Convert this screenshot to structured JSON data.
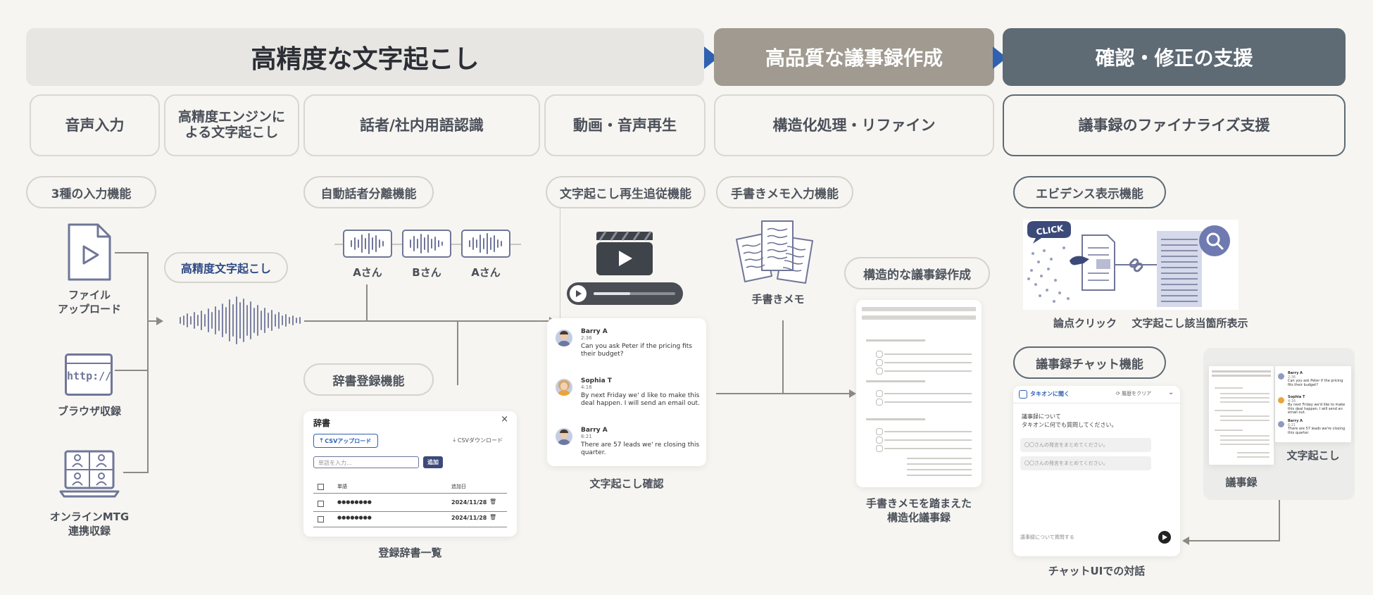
{
  "phases": [
    {
      "label": "高精度な文字起こし",
      "color": "#e7e6e3",
      "text_color": "#2b2e34"
    },
    {
      "label": "高品質な議事録作成",
      "color": "#a09a90",
      "text_color": "#ffffff"
    },
    {
      "label": "確認・修正の支援",
      "color": "#5e6a74",
      "text_color": "#ffffff"
    }
  ],
  "features": [
    "音声入力",
    "高精度エンジンによる文字起こし",
    "話者/社内用語認識",
    "動画・音声再生",
    "構造化処理・リファイン",
    "議事録のファイナライズ支援"
  ],
  "functions": {
    "input": "3種の入力機能",
    "diarization": "自動話者分離機能",
    "playback_follow": "文字起こし再生追従機能",
    "handwritten_input": "手書きメモ入力機能",
    "structured_minutes": "構造的な議事録作成",
    "evidence": "エビデンス表示機能",
    "dictionary": "辞書登録機能",
    "minutes_chat": "議事録チャット機能",
    "high_precision": "高精度文字起こし"
  },
  "inputs": {
    "file_upload": [
      "ファイル",
      "アップロード"
    ],
    "browser": "ブラウザ収録",
    "browser_url": "http://",
    "online": [
      "オンラインMTG",
      "連携収録"
    ]
  },
  "speakers": [
    "Aさん",
    "Bさん",
    "Aさん"
  ],
  "captions": {
    "dictionary_list": "登録辞書一覧",
    "transcript_check": "文字起こし確認",
    "handwritten_memo": "手書きメモ",
    "structured_result": [
      "手書きメモを踏まえた",
      "構造化議事録"
    ],
    "point_click": "論点クリック",
    "show_location": "文字起こし該当箇所表示",
    "chat_dialogue": "チャットUIでの対話",
    "minutes": "議事録",
    "transcript": "文字起こし"
  },
  "evidence": {
    "click_badge": "CLICK"
  },
  "dictionary_ui": {
    "title": "辞書",
    "close": "×",
    "upload_btn": "CSVアップロード",
    "download_btn": "CSVダウンロード",
    "input_placeholder": "単語を入力...",
    "add_btn": "追加",
    "col_word": "単語",
    "col_date": "追加日",
    "rows": [
      {
        "word": "●●●●●●●●",
        "date": "2024/11/28"
      },
      {
        "word": "●●●●●●●●",
        "date": "2024/11/28"
      }
    ]
  },
  "transcript_messages": [
    {
      "name": "Barry A",
      "time": "2:36",
      "text": "Can you ask Peter if the pricing fits their budget?"
    },
    {
      "name": "Sophia T",
      "time": "4:16",
      "text": "By next Friday we' d like to make this deal happen. I will send an email out."
    },
    {
      "name": "Barry A",
      "time": "6:21",
      "text": "There are 57 leads we' re closing this quarter."
    }
  ],
  "chat_ui": {
    "header_title": "タキオンに聞く",
    "clear_history": "履歴をクリア",
    "intro_line1": "議事録について",
    "intro_line2": "タキオンに何でも質問してください。",
    "suggestion1": "〇〇さんの発言をまとめてください。",
    "suggestion2": "〇〇さんの発言をまとめてください。",
    "input_placeholder": "議事録について質問する"
  },
  "mini_transcript": [
    {
      "name": "Barry A",
      "time": "2:36",
      "text": "Can you ask Peter if the pricing fits their budget?"
    },
    {
      "name": "Sophia T",
      "time": "4:16",
      "text": "By next Friday we'd like to make this deal happen. I will send an email out."
    },
    {
      "name": "Barry A",
      "time": "6:21",
      "text": "There are 57 leads we're closing this quarter."
    }
  ],
  "colors": {
    "accent": "#2f61b3",
    "navy": "#3c4a7a",
    "line": "#8d8a84"
  }
}
